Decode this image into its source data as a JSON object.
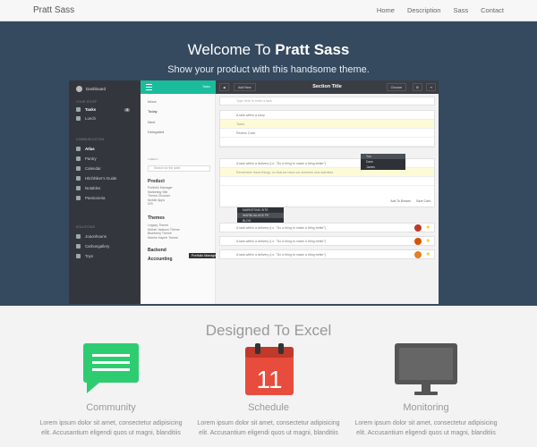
{
  "navbar": {
    "brand": "Pratt Sass",
    "links": [
      "Home",
      "Description",
      "Sass",
      "Contact"
    ]
  },
  "hero": {
    "title_prefix": "Welcome To ",
    "title_strong": "Pratt Sass",
    "subtitle": "Show your product with this handsome theme."
  },
  "mockup": {
    "sidebar": {
      "dashboard": "Dashboard",
      "section1": "YOUR STUFF",
      "items1": [
        {
          "label": "Tasks",
          "badge": "3"
        },
        {
          "label": "Lunch"
        }
      ],
      "section2": "COMMUNICATION",
      "items2": [
        "Atlas",
        "Pantry",
        "Calendar",
        "Hitchhiker's Guide",
        "Notables",
        "Pasticcieria"
      ],
      "section3": "SOLUTIONS",
      "items3": [
        "Joaonhouns",
        "Carbongallery",
        "Toys"
      ]
    },
    "col2": {
      "head_label": "Tasks",
      "items": [
        "Inbox",
        "Today",
        "Next",
        "Delegated"
      ],
      "search_label": "LABELS",
      "search_placeholder": "Search for the label",
      "product_head": "Product",
      "product_items": "Portfolio Manager\nMarketing Site\nTheme Chooser\nMobile Apps\niOS",
      "themes_head": "Themes",
      "themes_items": "Legacy Theme\nMichel Jackson Theme\nBlueberry Theme\nMarine Inspire Theme",
      "backend_head": "Backend",
      "accounting_head": "Accounting",
      "tooltip": "Portfolio Manager"
    },
    "main": {
      "add_btn": "Add New",
      "title": "Section Title",
      "choose_btn": "Choose",
      "input_placeholder": "Type here to enter a task",
      "rows": [
        "A task within a story",
        "Tasks",
        "Review Code",
        "A task within a delivery (i.e. \"Do a thing to make a thing better\")",
        "Remember these things, so that we have our archives new activities",
        "A task within a delivery (i.e. \"Do a thing to make a thing better\")",
        "A task within a delivery (i.e. \"Do a thing to make a thing better\")",
        "A task within a delivery (i.e. \"Do a thing to make a thing better\")"
      ],
      "dropdown_people": [
        "You",
        "Dave",
        "James"
      ],
      "dropdown_tags": [
        "MARKETING SITE",
        "WARBLIALADE PE",
        "BLOG"
      ],
      "footer_btns": [
        "Add To Bosses",
        "Save Card"
      ]
    }
  },
  "features": {
    "title": "Designed To Excel",
    "items": [
      {
        "name": "Community",
        "desc": "Lorem ipsum dolor sit amet, consectetur adipisicing elit. Accusantium eligendi quos ut magni, blanditiis"
      },
      {
        "name": "Schedule",
        "desc": "Lorem ipsum dolor sit amet, consectetur adipisicing elit. Accusantium eligendi quos ut magni, blanditiis"
      },
      {
        "name": "Monitoring",
        "desc": "Lorem ipsum dolor sit amet, consectetur adipisicing elit. Accusantium eligendi quos ut magni, blanditiis"
      }
    ],
    "calendar_day": "11",
    "colors": {
      "community": "#2ecc71",
      "schedule": "#e74c3c",
      "monitoring": "#555555"
    }
  }
}
